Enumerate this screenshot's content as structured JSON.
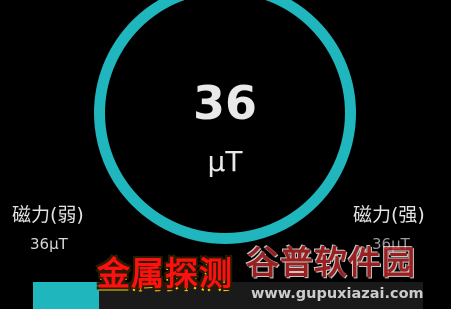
{
  "meter": {
    "reading_value": "36",
    "reading_unit": "μT",
    "ring_color": "#1fb6bd"
  },
  "scale": {
    "weak_label": "磁力(弱)",
    "weak_value": "36μT",
    "strong_label": "磁力(强)",
    "strong_value": "36μT"
  },
  "strength_bar": {
    "fill_fraction": 0.17,
    "color": "#1fb6bd"
  },
  "banner": {
    "title": "金属探测"
  },
  "watermark": {
    "logo_text": "谷普软件园",
    "url": "www.gupuxiazai.com"
  }
}
